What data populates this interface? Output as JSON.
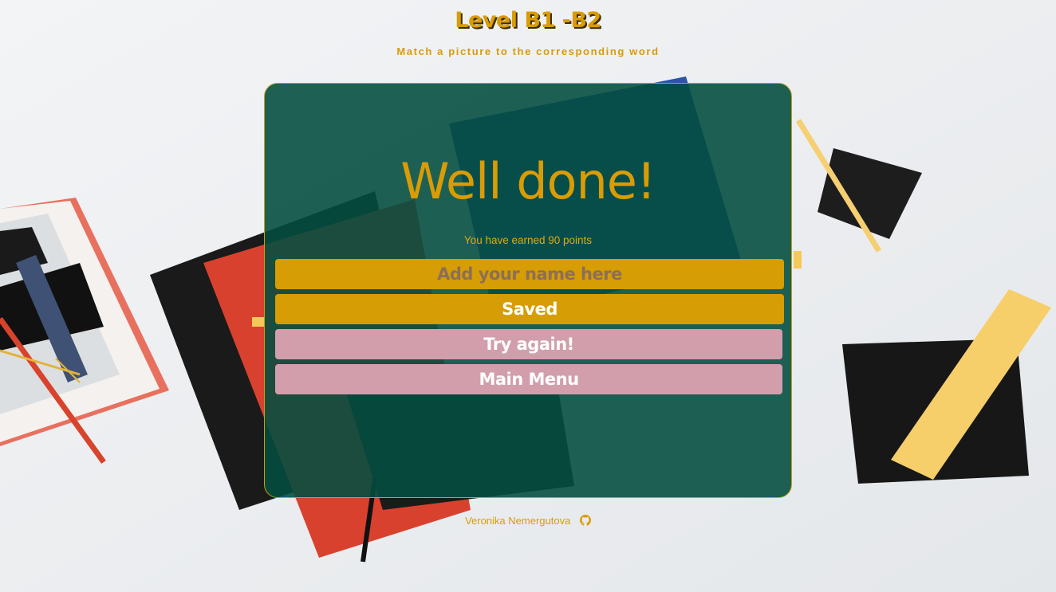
{
  "header": {
    "title": "Level B1 -B2",
    "subtitle": "Match a picture to the corresponding word"
  },
  "result": {
    "headline": "Well done!",
    "points_text": "You have earned 90 points"
  },
  "form": {
    "name_placeholder": "Add your name here",
    "name_value": "",
    "saved_label": "Saved"
  },
  "actions": {
    "try_again_label": "Try again!",
    "main_menu_label": "Main Menu"
  },
  "footer": {
    "author": "Veronika Nemergutova",
    "icon": "github-icon"
  },
  "colors": {
    "accent": "#d99c05",
    "card_bg": "#034d3f",
    "pink_button": "#d29eab",
    "yellow_button": "#d69d04"
  }
}
